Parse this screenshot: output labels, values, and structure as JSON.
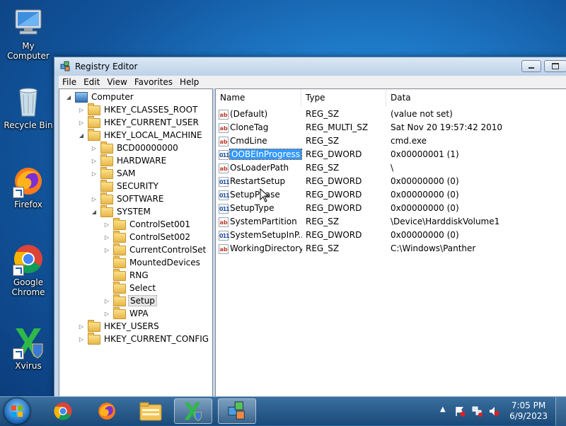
{
  "desktop": {
    "icons": [
      {
        "label": "My Computer",
        "icon": "computer-icon"
      },
      {
        "label": "Recycle Bin",
        "icon": "recycle-bin-icon"
      },
      {
        "label": "Firefox",
        "icon": "firefox-icon"
      },
      {
        "label": "Google Chrome",
        "icon": "chrome-icon"
      },
      {
        "label": "Xvirus",
        "icon": "xvirus-icon"
      }
    ]
  },
  "window": {
    "title": "Registry Editor",
    "menu": [
      "File",
      "Edit",
      "View",
      "Favorites",
      "Help"
    ],
    "tree": [
      {
        "label": "Computer",
        "expander": "◢",
        "icon": "computer-icon"
      },
      {
        "label": "HKEY_CLASSES_ROOT",
        "expander": "▷"
      },
      {
        "label": "HKEY_CURRENT_USER",
        "expander": "▷"
      },
      {
        "label": "HKEY_LOCAL_MACHINE",
        "expander": "◢"
      },
      {
        "label": "BCD00000000",
        "expander": "▷"
      },
      {
        "label": "HARDWARE",
        "expander": "▷"
      },
      {
        "label": "SAM",
        "expander": "▷"
      },
      {
        "label": "SECURITY",
        "expander": ""
      },
      {
        "label": "SOFTWARE",
        "expander": "▷"
      },
      {
        "label": "SYSTEM",
        "expander": "◢"
      },
      {
        "label": "ControlSet001",
        "expander": "▷"
      },
      {
        "label": "ControlSet002",
        "expander": "▷"
      },
      {
        "label": "CurrentControlSet",
        "expander": "▷"
      },
      {
        "label": "MountedDevices",
        "expander": ""
      },
      {
        "label": "RNG",
        "expander": ""
      },
      {
        "label": "Select",
        "expander": ""
      },
      {
        "label": "Setup",
        "expander": "▷",
        "selected": true
      },
      {
        "label": "WPA",
        "expander": "▷"
      },
      {
        "label": "HKEY_USERS",
        "expander": "▷"
      },
      {
        "label": "HKEY_CURRENT_CONFIG",
        "expander": "▷"
      }
    ],
    "columns": [
      "Name",
      "Type",
      "Data"
    ],
    "values": [
      {
        "name": "(Default)",
        "type": "REG_SZ",
        "data": "(value not set)",
        "icon": "ab"
      },
      {
        "name": "CloneTag",
        "type": "REG_MULTI_SZ",
        "data": "Sat Nov 20 19:57:42 2010",
        "icon": "ab"
      },
      {
        "name": "CmdLine",
        "type": "REG_SZ",
        "data": "cmd.exe",
        "icon": "ab"
      },
      {
        "name": "OOBEInProgress",
        "type": "REG_DWORD",
        "data": "0x00000001 (1)",
        "icon": "bin",
        "selected": true
      },
      {
        "name": "OsLoaderPath",
        "type": "REG_SZ",
        "data": "\\",
        "icon": "ab"
      },
      {
        "name": "RestartSetup",
        "type": "REG_DWORD",
        "data": "0x00000000 (0)",
        "icon": "bin"
      },
      {
        "name": "SetupPhase",
        "type": "REG_DWORD",
        "data": "0x00000000 (0)",
        "icon": "bin"
      },
      {
        "name": "SetupType",
        "type": "REG_DWORD",
        "data": "0x00000000 (0)",
        "icon": "bin"
      },
      {
        "name": "SystemPartition",
        "type": "REG_SZ",
        "data": "\\Device\\HarddiskVolume1",
        "icon": "ab"
      },
      {
        "name": "SystemSetupInP...",
        "type": "REG_DWORD",
        "data": "0x00000000 (0)",
        "icon": "bin"
      },
      {
        "name": "WorkingDirectory",
        "type": "REG_SZ",
        "data": "C:\\Windows\\Panther",
        "icon": "ab"
      }
    ]
  },
  "taskbar": {
    "items": [
      "start-orb",
      "chrome-icon",
      "firefox-icon",
      "file-explorer-icon",
      "xvirus-icon",
      "registry-editor-icon"
    ],
    "tray_icons": [
      "show-hidden-icons-icon",
      "action-center-icon",
      "network-icon",
      "volume-muted-icon"
    ],
    "time": "7:05 PM",
    "date": "6/9/2023"
  }
}
